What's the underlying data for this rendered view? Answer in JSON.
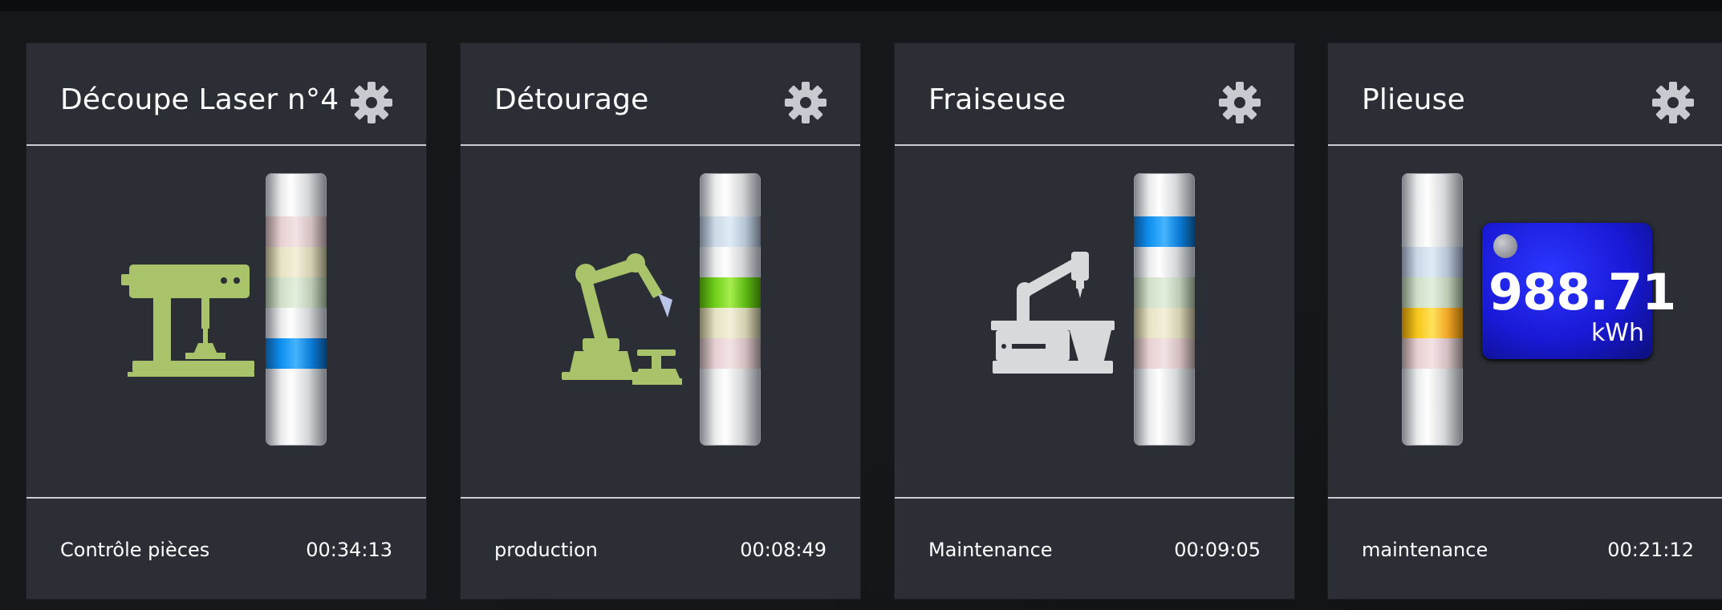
{
  "cards": [
    {
      "title": "Découpe Laser n°4",
      "status": "Contrôle pièces",
      "time": "00:34:13",
      "icon": "drill-press-icon",
      "tower": [
        "white",
        "red-dim",
        "yellow-dim",
        "green-dim",
        "white",
        "blue",
        "white"
      ]
    },
    {
      "title": "Détourage",
      "status": "production",
      "time": "00:08:49",
      "icon": "robot-arm-icon",
      "tower": [
        "white",
        "blue-dim",
        "white",
        "green",
        "yellow-dim",
        "red-dim",
        "white"
      ]
    },
    {
      "title": "Fraiseuse",
      "status": "Maintenance",
      "time": "00:09:05",
      "icon": "milling-machine-icon",
      "tower": [
        "white",
        "blue",
        "white",
        "green-dim",
        "yellow-dim",
        "red-dim",
        "white"
      ]
    },
    {
      "title": "Plieuse",
      "status": "maintenance",
      "time": "00:21:12",
      "icon": "press-brake-icon",
      "tower": [
        "white",
        "white",
        "blue-dim",
        "green-dim",
        "yellow",
        "red-dim",
        "white"
      ],
      "energy": {
        "value": "988.71",
        "unit": "kWh"
      }
    }
  ],
  "colors": {
    "card_bg": "#2b2e34",
    "divider": "#c9ccd1",
    "icon_green": "#a9c36a",
    "icon_grey": "#d8d9db",
    "blue": "#0e8ff0",
    "green": "#6fcf1a",
    "yellow": "#f7c51a",
    "energy_bg": "#1919d6"
  }
}
